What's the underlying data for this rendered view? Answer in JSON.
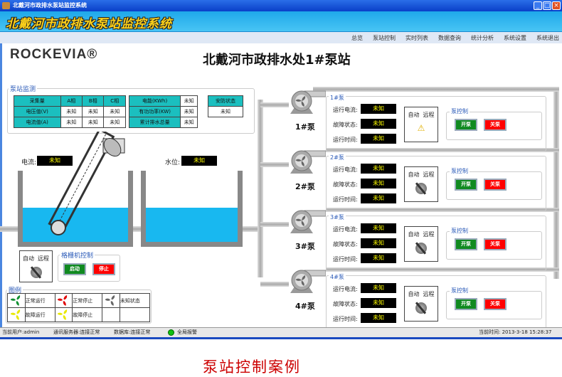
{
  "window": {
    "title": "北戴河市政排水泵站监控系统",
    "app_title": "北戴河市政排水泵站监控系统",
    "controls": [
      "minimize",
      "maximize",
      "close"
    ]
  },
  "menu": [
    "总览",
    "泵站控制",
    "实时列表",
    "数据查询",
    "统计分析",
    "系统设置",
    "系统退出"
  ],
  "logo": "ROCKEVIA®",
  "page_title": "北戴河市政排水处1#泵站",
  "monitor": {
    "label": "泵站监测",
    "table1": {
      "headers": [
        "采集量",
        "A相",
        "B相",
        "C相"
      ],
      "rows": [
        [
          "电压值(V)",
          "未知",
          "未知",
          "未知"
        ],
        [
          "电流值(A)",
          "未知",
          "未知",
          "未知"
        ]
      ]
    },
    "table2": [
      [
        "电能(KWh)",
        "未知"
      ],
      [
        "有功功率(KW)",
        "未知"
      ],
      [
        "累计排水总量",
        "未知"
      ]
    ],
    "security": {
      "label": "安防状态",
      "value": "未知"
    }
  },
  "current": {
    "label": "电流:",
    "value": "未知"
  },
  "level": {
    "label": "水位:",
    "value": "未知"
  },
  "grille": {
    "mode_auto": "自动",
    "mode_remote": "远程",
    "control_label": "格栅机控制",
    "start": "启动",
    "stop": "停止"
  },
  "legend": {
    "label": "图例",
    "items": [
      {
        "text": "正常运行",
        "color": "#109030"
      },
      {
        "text": "正常停止",
        "color": "#e00000"
      },
      {
        "text": "未知状态",
        "color": "#666666"
      },
      {
        "text": "故障运行",
        "color": "#e8e800"
      },
      {
        "text": "故障停止",
        "color": "#e8e800"
      }
    ]
  },
  "pumps": [
    {
      "name": "1#泵",
      "group": "1#泵",
      "current_label": "运行电流:",
      "current": "未知",
      "fault_label": "故障状态:",
      "fault": "未知",
      "time_label": "运行时间:",
      "time": "未知",
      "auto": "自动",
      "remote": "远程",
      "state": "warning",
      "control_label": "泵控制",
      "on": "开泵",
      "off": "关泵"
    },
    {
      "name": "2#泵",
      "group": "2#泵",
      "current_label": "运行电流:",
      "current": "未知",
      "fault_label": "故障状态:",
      "fault": "未知",
      "time_label": "运行时间:",
      "time": "未知",
      "auto": "自动",
      "remote": "远程",
      "state": "knob",
      "control_label": "泵控制",
      "on": "开泵",
      "off": "关泵"
    },
    {
      "name": "3#泵",
      "group": "3#泵",
      "current_label": "运行电流:",
      "current": "未知",
      "fault_label": "故障状态:",
      "fault": "未知",
      "time_label": "运行时间:",
      "time": "未知",
      "auto": "自动",
      "remote": "远程",
      "state": "knob",
      "control_label": "泵控制",
      "on": "开泵",
      "off": "关泵"
    },
    {
      "name": "4#泵",
      "group": "4#泵",
      "current_label": "运行电流:",
      "current": "未知",
      "fault_label": "故障状态:",
      "fault": "未知",
      "time_label": "运行时间:",
      "time": "未知",
      "auto": "自动",
      "remote": "远程",
      "state": "knob",
      "control_label": "泵控制",
      "on": "开泵",
      "off": "关泵"
    }
  ],
  "status": {
    "user": "当前用户:admin",
    "server": "通讯服务器:连接正常",
    "db": "数据库:连接正常",
    "alarm": "全局报警",
    "time": "当前时间: 2013-3-18 15:28:37",
    "alarm_color": "#10c010"
  },
  "caption": "泵站控制案例"
}
